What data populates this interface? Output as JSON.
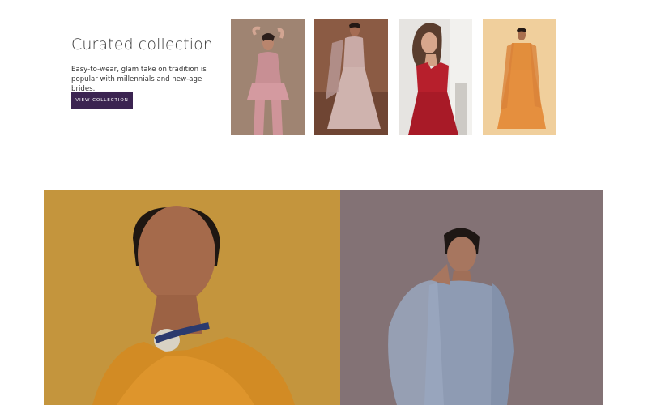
{
  "curated": {
    "title": "Curated collection",
    "description": "Easy-to-wear, glam take on tradition is popular with millennials and new-age brides.",
    "button_label": "VIEW COLLECTION"
  },
  "colors": {
    "button_bg": "#3b2451",
    "page_bg": "#ffffff"
  },
  "thumbnails": [
    {
      "name": "pink-peplum-sharara-outfit"
    },
    {
      "name": "dusty-pink-lehenga-outfit"
    },
    {
      "name": "red-gown-outfit"
    },
    {
      "name": "orange-lehenga-outfit"
    }
  ],
  "hero_images": [
    {
      "name": "mustard-lehenga-portrait"
    },
    {
      "name": "grey-blue-anarkali-portrait"
    }
  ]
}
